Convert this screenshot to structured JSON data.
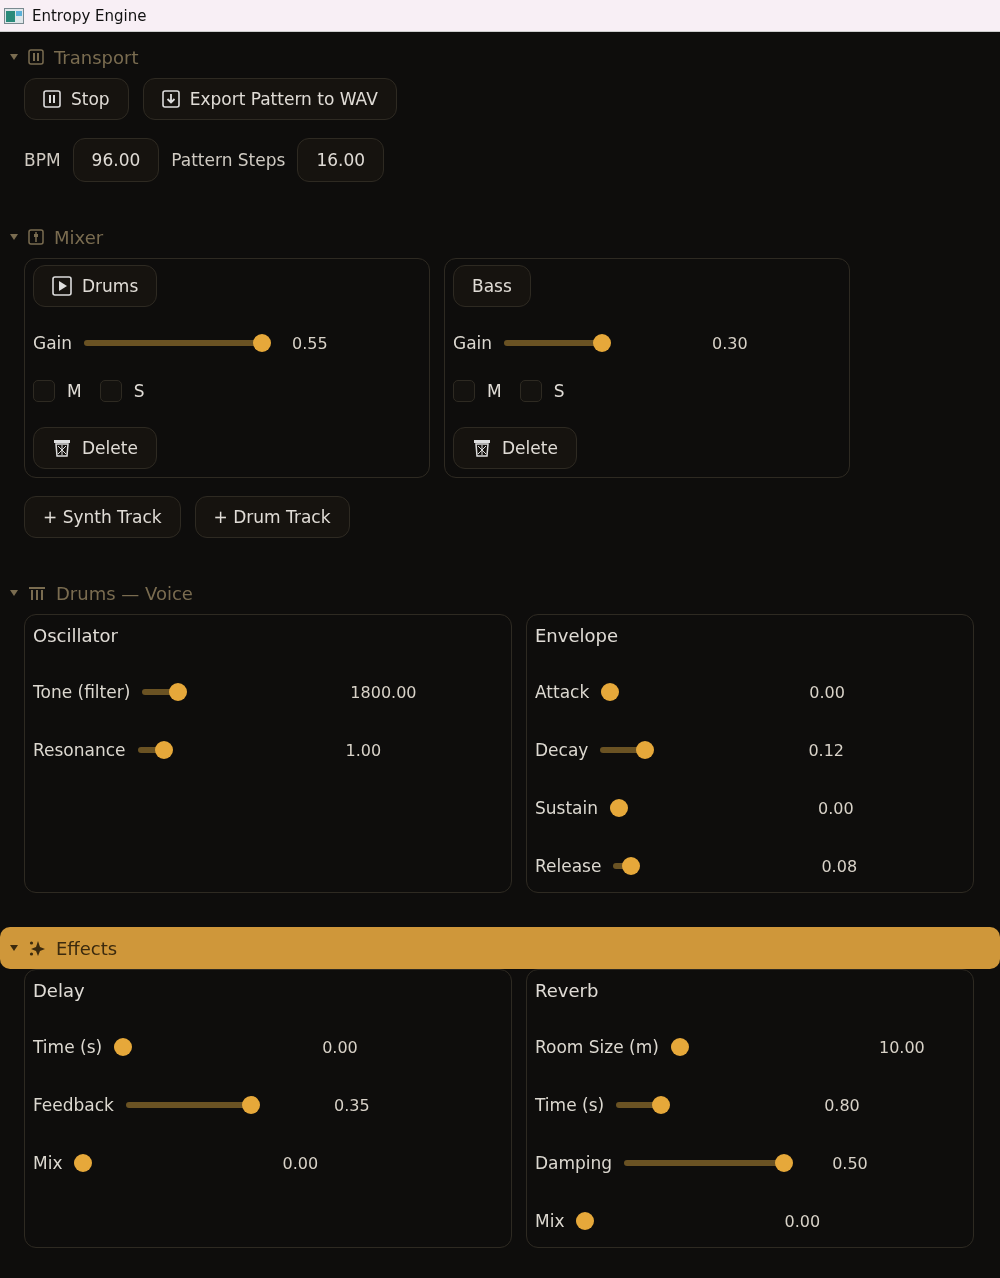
{
  "window": {
    "title": "Entropy Engine"
  },
  "sections": [
    {
      "title": "Transport",
      "kind": "transport",
      "selected": false,
      "expanded": true,
      "buttons": [
        {
          "label": "Stop"
        },
        {
          "label": "Export Pattern to WAV"
        }
      ],
      "fields": [
        {
          "label": "BPM",
          "value": "96.00"
        },
        {
          "label": "Pattern Steps",
          "value": "16.00"
        }
      ]
    },
    {
      "title": "Mixer",
      "kind": "mixer",
      "selected": false,
      "expanded": true,
      "tracks": [
        {
          "name": "Drums",
          "playing": true,
          "gain": {
            "label": "Gain",
            "reading": "0.55",
            "level": 0.95
          },
          "mute": {
            "label": "M",
            "checked": false
          },
          "solo": {
            "label": "S",
            "checked": false
          },
          "delete_label": "Delete"
        },
        {
          "name": "Bass",
          "playing": false,
          "gain": {
            "label": "Gain",
            "reading": "0.30",
            "level": 0.5
          },
          "mute": {
            "label": "M",
            "checked": false
          },
          "solo": {
            "label": "S",
            "checked": false
          },
          "delete_label": "Delete"
        }
      ],
      "add_buttons": [
        "+ Synth Track",
        "+ Drum Track"
      ]
    },
    {
      "title": "Drums — Voice",
      "kind": "panels",
      "selected": false,
      "expanded": true,
      "panels": [
        {
          "title": "Oscillator",
          "sliders": [
            {
              "label": "Tone (filter)",
              "reading": "1800.00",
              "level": 0.15
            },
            {
              "label": "Resonance",
              "reading": "1.00",
              "level": 0.1
            }
          ]
        },
        {
          "title": "Envelope",
          "sliders": [
            {
              "label": "Attack",
              "reading": "0.00",
              "level": 0
            },
            {
              "label": "Decay",
              "reading": "0.12",
              "level": 0.2
            },
            {
              "label": "Sustain",
              "reading": "0.00",
              "level": 0
            },
            {
              "label": "Release",
              "reading": "0.08",
              "level": 0.05
            }
          ]
        }
      ]
    },
    {
      "title": "Effects",
      "kind": "panels",
      "selected": true,
      "expanded": true,
      "panels": [
        {
          "title": "Delay",
          "sliders": [
            {
              "label": "Time (s)",
              "reading": "0.00",
              "level": 0
            },
            {
              "label": "Feedback",
              "reading": "0.35",
              "level": 0.65
            },
            {
              "label": "Mix",
              "reading": "0.00",
              "level": 0
            }
          ]
        },
        {
          "title": "Reverb",
          "sliders": [
            {
              "label": "Room Size (m)",
              "reading": "10.00",
              "level": 0
            },
            {
              "label": "Time (s)",
              "reading": "0.80",
              "level": 0.2
            },
            {
              "label": "Damping",
              "reading": "0.50",
              "level": 0.85
            },
            {
              "label": "Mix",
              "reading": "0.00",
              "level": 0
            }
          ]
        }
      ]
    }
  ]
}
